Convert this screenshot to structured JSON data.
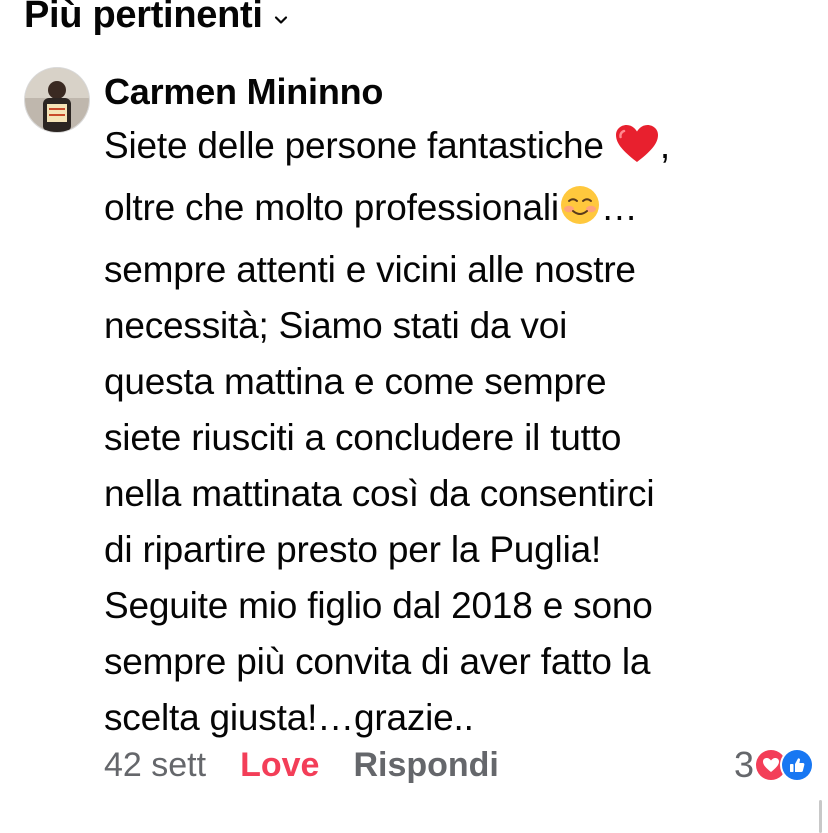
{
  "sort": {
    "label": "Più pertinenti",
    "icon": "chevron-down-icon"
  },
  "comment": {
    "author": "Carmen Mininno",
    "avatar_icon": "profile-photo",
    "text_line_1": "Siete delle persone fantastiche ",
    "text_after_heart": ",",
    "text_line_2": "oltre che molto professionali",
    "text_after_smile": "…",
    "text_rest": "sempre attenti e vicini alle nostre\nnecessità; Siamo stati da voi\nquesta mattina e come sempre\nsiete riusciti a concludere il tutto\nnella mattinata così da consentirci\ndi ripartire presto per la Puglia!\nSeguite mio figlio dal 2018 e sono\nsempre più convita di aver fatto la\nscelta giusta!…grazie..",
    "heart_emoji": "red-heart-emoji",
    "smile_emoji": "smiling-face-emoji"
  },
  "actions": {
    "time": "42 sett",
    "love": "Love",
    "reply": "Rispondi"
  },
  "reactions": {
    "count": "3",
    "icons": [
      "love-reaction-icon",
      "like-reaction-icon"
    ]
  },
  "colors": {
    "love": "#f33e58",
    "like": "#1877f2",
    "muted": "#65676b",
    "text": "#050505"
  }
}
